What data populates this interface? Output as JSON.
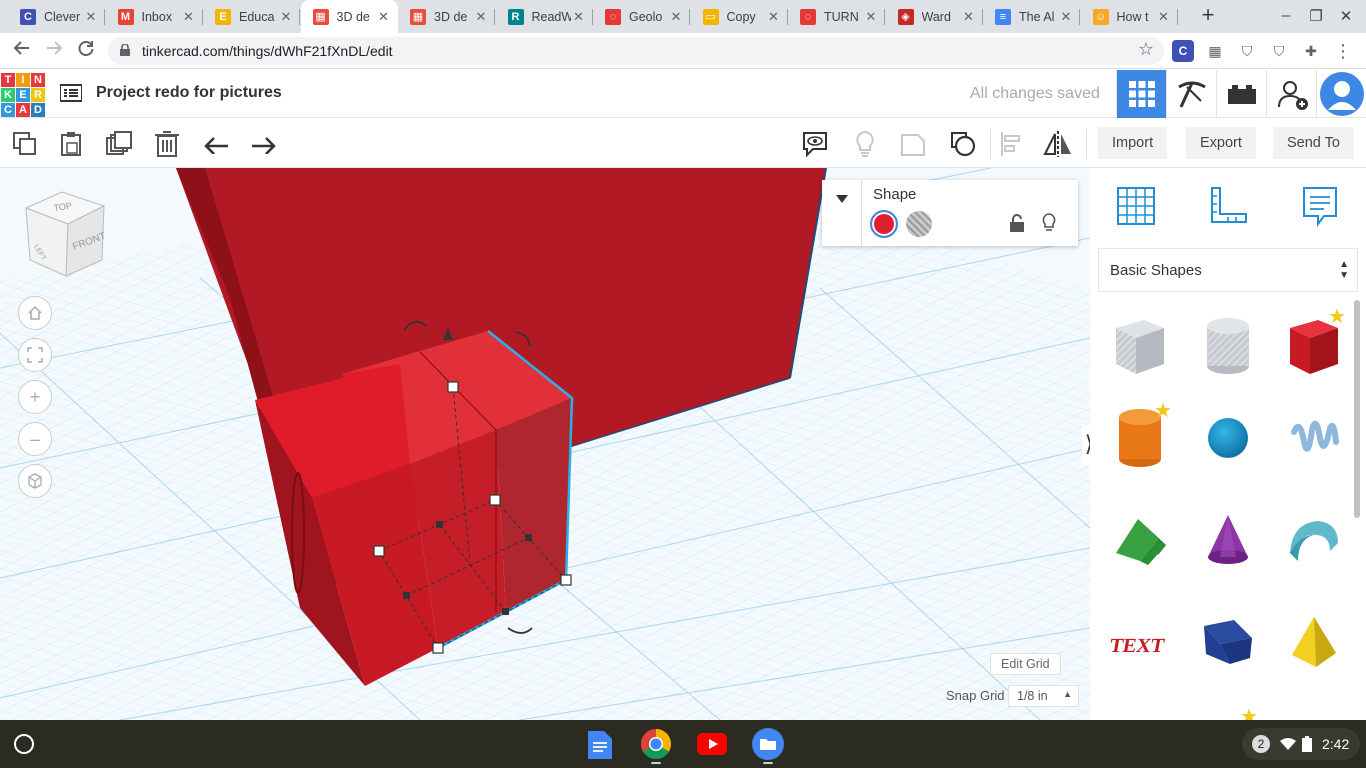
{
  "browser": {
    "tabs": [
      {
        "label": "Clever",
        "icon": "clever-icon",
        "color": "#3f51b5",
        "glyph": "C"
      },
      {
        "label": "Inbox",
        "icon": "gmail-icon",
        "color": "#ea4335",
        "glyph": "M"
      },
      {
        "label": "Educa",
        "icon": "education-icon",
        "color": "#f4b400",
        "glyph": "E"
      },
      {
        "label": "3D de",
        "icon": "tinkercad-icon",
        "color": "#e74c3c",
        "glyph": "▦",
        "active": true
      },
      {
        "label": "3D de",
        "icon": "tinkercad-icon",
        "color": "#e74c3c",
        "glyph": "▦"
      },
      {
        "label": "ReadW",
        "icon": "readworks-icon",
        "color": "#00838f",
        "glyph": "R"
      },
      {
        "label": "Geolo",
        "icon": "target-icon",
        "color": "#e53935",
        "glyph": "◌"
      },
      {
        "label": "Copy",
        "icon": "slides-icon",
        "color": "#f4b400",
        "glyph": "▭"
      },
      {
        "label": "TURN",
        "icon": "target-icon",
        "color": "#e53935",
        "glyph": "◌"
      },
      {
        "label": "Ward",
        "icon": "app-icon",
        "color": "#c62828",
        "glyph": "◈"
      },
      {
        "label": "The Al",
        "icon": "docs-icon",
        "color": "#4285f4",
        "glyph": "≡"
      },
      {
        "label": "How t",
        "icon": "avatar-icon",
        "color": "#f9a825",
        "glyph": "☺"
      }
    ],
    "url": "tinkercad.com/things/dWhF21fXnDL/edit"
  },
  "header": {
    "logo_letters": [
      "T",
      "I",
      "N",
      "K",
      "E",
      "R",
      "C",
      "A",
      "D"
    ],
    "project_title": "Project redo for pictures",
    "save_status": "All changes saved"
  },
  "toolbar": {
    "import_label": "Import",
    "export_label": "Export",
    "sendto_label": "Send To"
  },
  "inspector": {
    "title": "Shape",
    "solid_color": "#e0202e",
    "hole_label": "hole"
  },
  "viewcube": {
    "top": "TOP",
    "left": "LEFT",
    "front": "FRONT"
  },
  "workplane": {
    "edit_grid_label": "Edit Grid",
    "snap_grid_label": "Snap Grid",
    "snap_grid_value": "1/8 in"
  },
  "library": {
    "selected": "Basic Shapes",
    "shapes": [
      "Box hole",
      "Cylinder hole",
      "Box",
      "Cylinder",
      "Sphere",
      "Scribble",
      "Roof",
      "Cone",
      "Round Roof",
      "Text",
      "Wedge",
      "Pyramid"
    ]
  },
  "shelf": {
    "notification_count": "2",
    "time": "2:42"
  },
  "colors": {
    "accent": "#3d88e4",
    "shape_red": "#c8202b",
    "grid_blue": "#9fd0f0"
  }
}
